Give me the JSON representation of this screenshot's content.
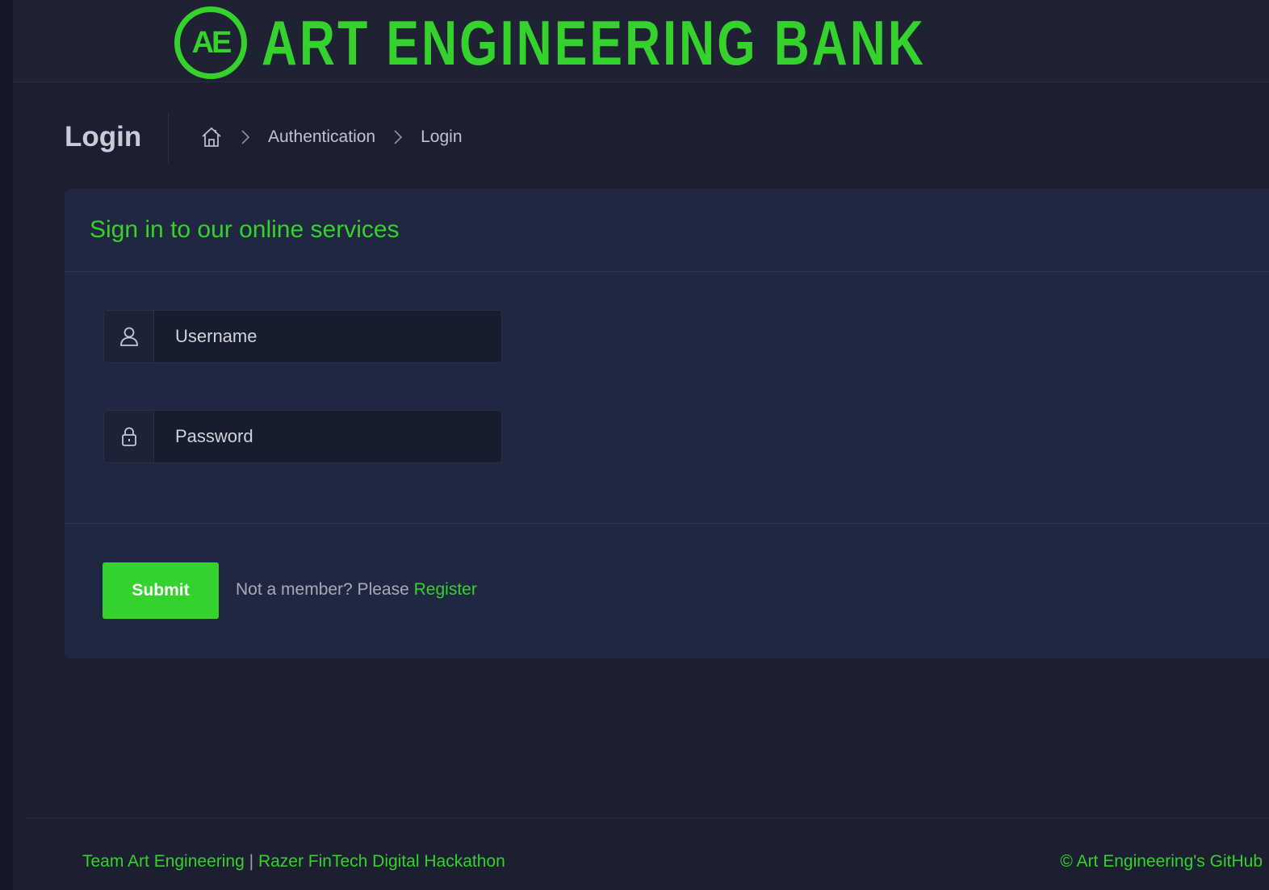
{
  "header": {
    "logo_badge": "AE",
    "brand_name": "ART ENGINEERING BANK",
    "brand_color": "#35d12d"
  },
  "page": {
    "title": "Login",
    "breadcrumb": {
      "home_icon": "home-icon",
      "items": [
        "Authentication",
        "Login"
      ]
    }
  },
  "card": {
    "title": "Sign in to our online services",
    "username": {
      "icon": "user-icon",
      "placeholder": "Username",
      "value": ""
    },
    "password": {
      "icon": "lock-icon",
      "placeholder": "Password",
      "value": ""
    },
    "submit_label": "Submit",
    "register_prompt": "Not a member? Please",
    "register_link": "Register"
  },
  "footer": {
    "left_part1": "Team Art Engineering",
    "separator": "|",
    "left_part2": "Razer FinTech Digital Hackathon",
    "right": "© Art Engineering's GitHub"
  }
}
